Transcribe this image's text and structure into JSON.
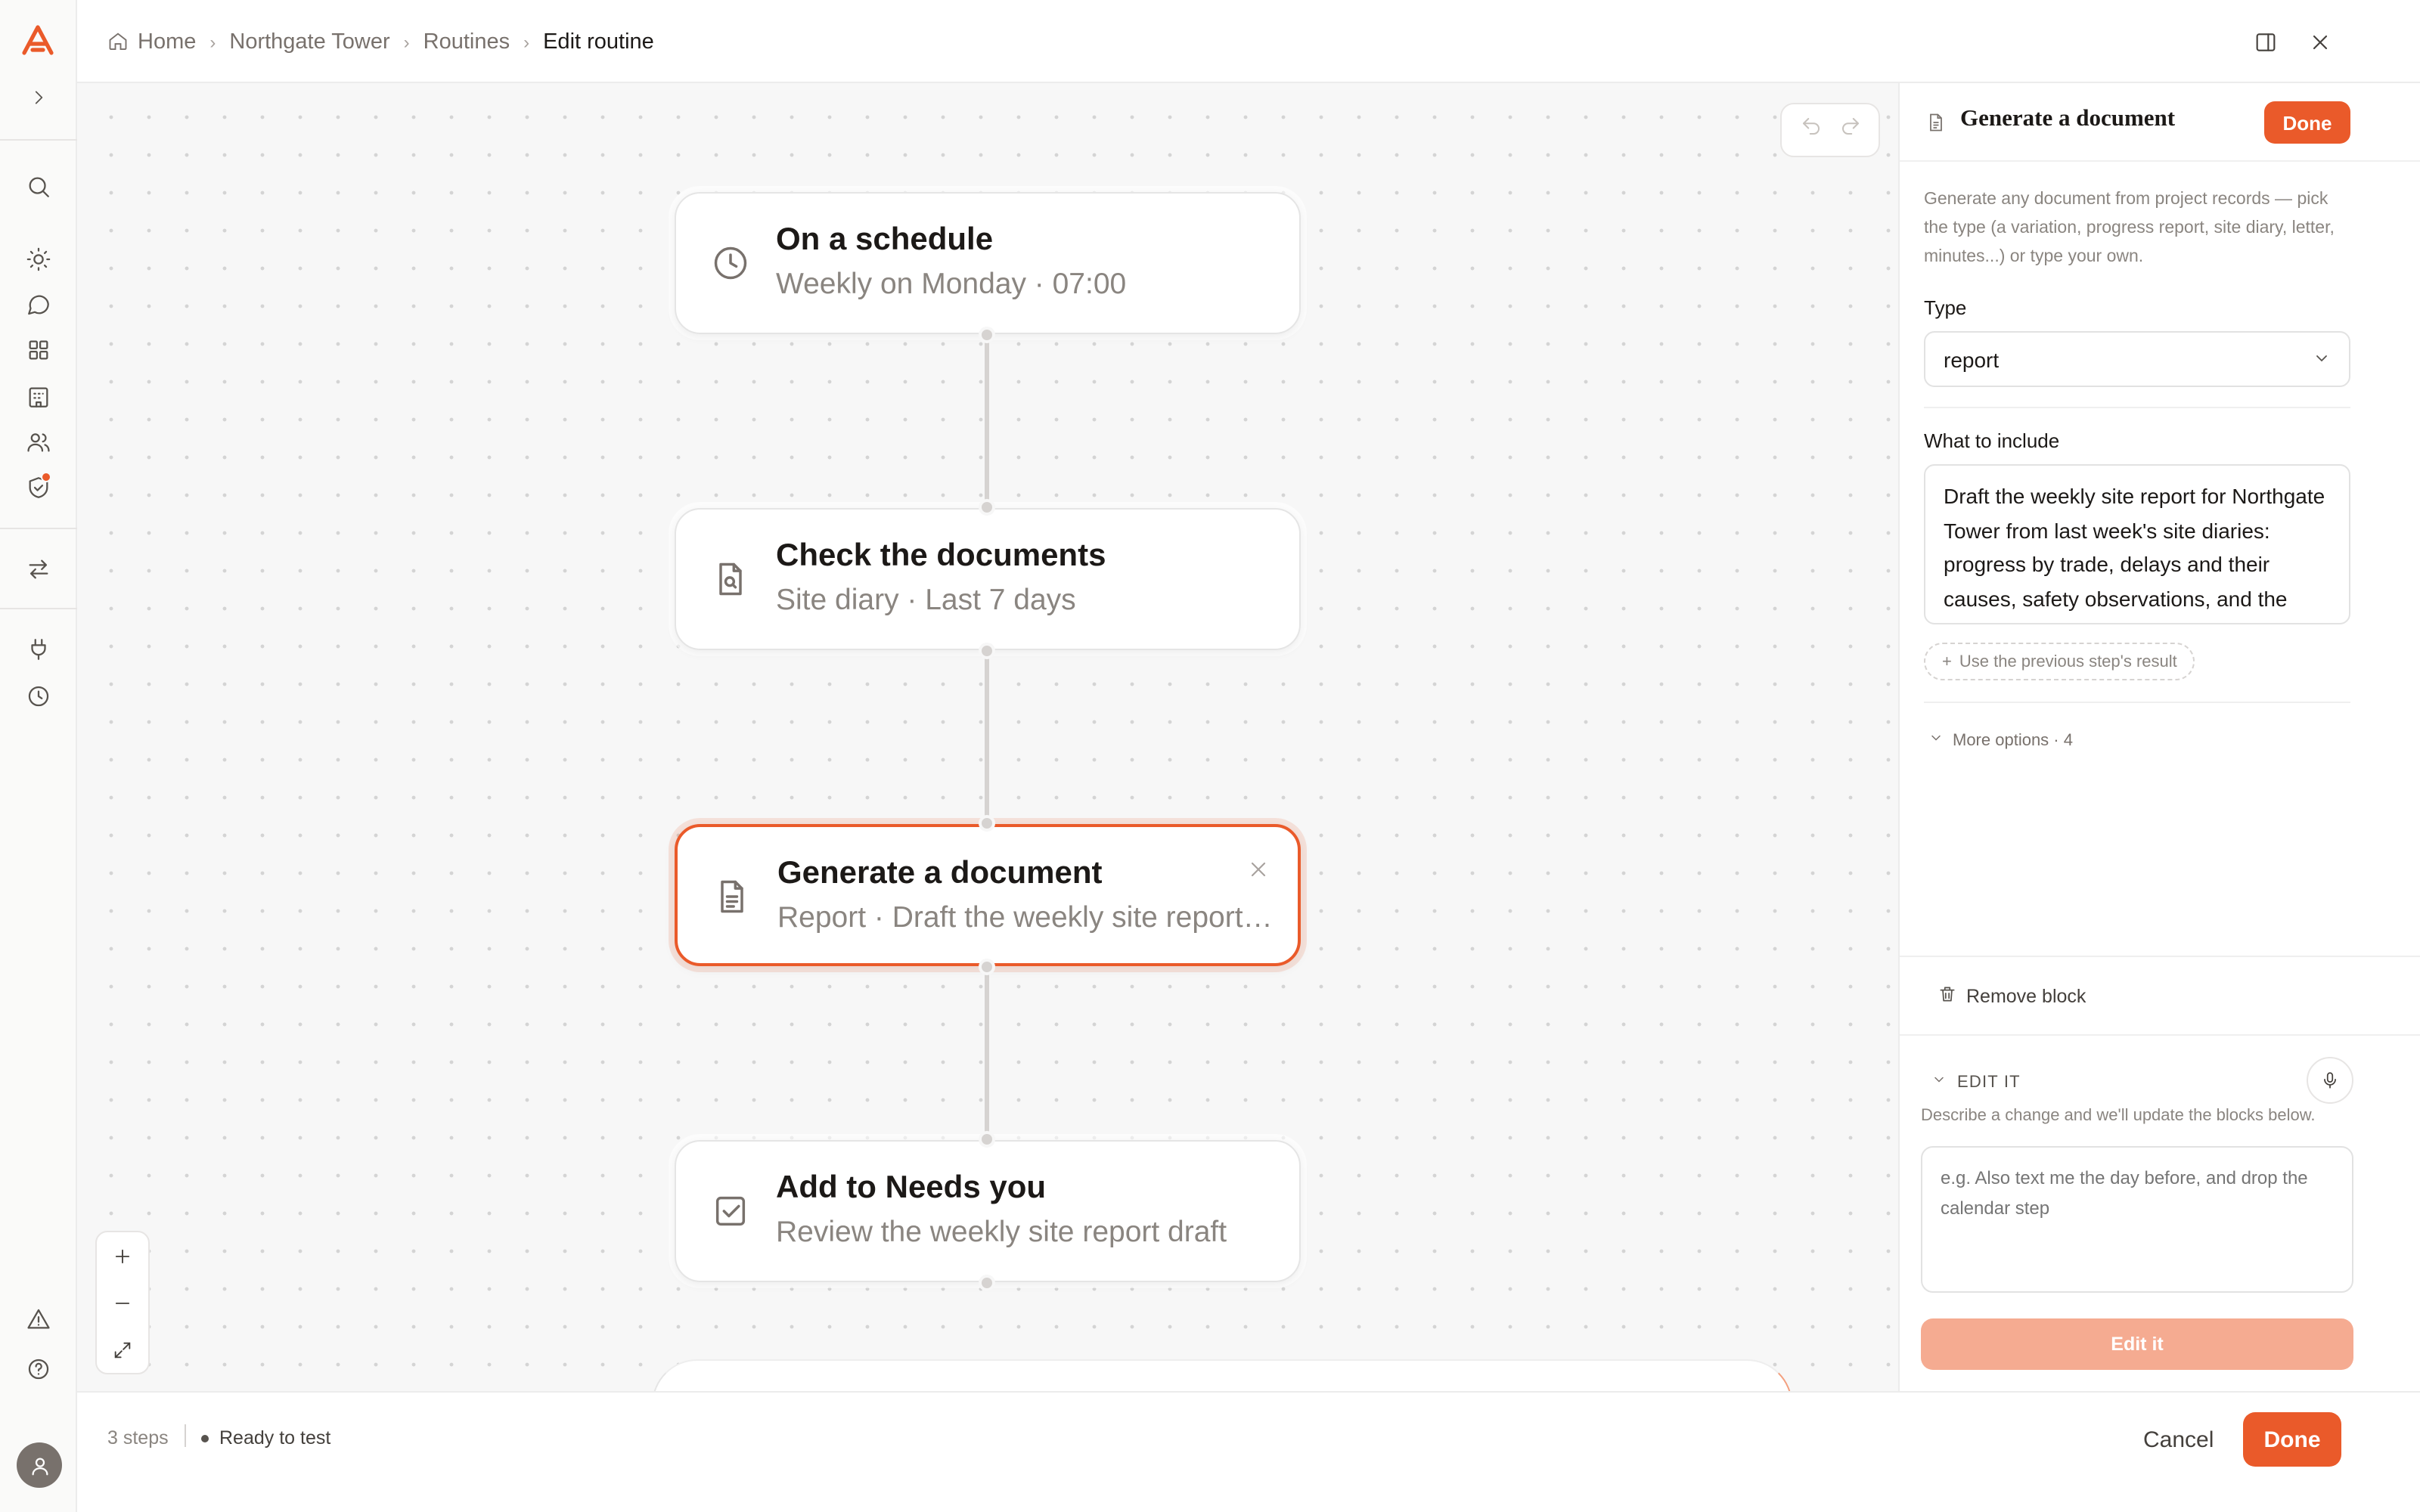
{
  "breadcrumbs": {
    "home": "Home",
    "project": "Northgate Tower",
    "section": "Routines",
    "current": "Edit routine"
  },
  "canvas": {
    "nodes": [
      {
        "title": "On a schedule",
        "subtitle": "Weekly on Monday · 07:00",
        "icon": "clock-icon"
      },
      {
        "title": "Check the documents",
        "subtitle": "Site diary · Last 7 days",
        "icon": "document-search-icon"
      },
      {
        "title": "Generate a document",
        "subtitle": "Report · Draft the weekly site report for Northgate Tower",
        "icon": "document-icon",
        "selected": true
      },
      {
        "title": "Add to Needs you",
        "subtitle": "Review the weekly site report draft",
        "icon": "checkbox-icon"
      }
    ]
  },
  "footer": {
    "steps": "3 steps",
    "status": "Ready to test",
    "cancel_label": "Cancel",
    "done_label": "Done"
  },
  "panel": {
    "title": "Generate a document",
    "done_label": "Done",
    "description": "Generate any document from project records — pick the type (a variation, progress report, site diary, letter, minutes...) or type your own.",
    "type_label": "Type",
    "type_value": "report",
    "include_label": "What to include",
    "include_value": "Draft the weekly site report for Northgate Tower from last week's site diaries: progress by trade, delays and their causes, safety observations, and the look-ahead for the coming week.",
    "use_previous_label": "Use the previous step's result",
    "more_options_label": "More options · 4",
    "remove_label": "Remove block",
    "edit_heading": "EDIT IT",
    "edit_hint": "Describe a change and we'll update the blocks below.",
    "edit_placeholder": "e.g. Also text me the day before, and drop the calendar step",
    "edit_button": "Edit it"
  },
  "colors": {
    "accent": "#ea5a2a",
    "accent_disabled": "#f5ab91"
  }
}
